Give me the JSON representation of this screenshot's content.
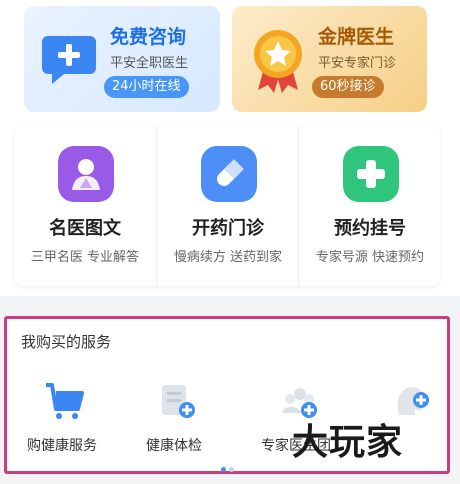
{
  "cards": [
    {
      "title": "免费咨询",
      "subtitle": "平安全职医生",
      "pill": "24小时在线",
      "icon": "chat-plus-icon"
    },
    {
      "title": "金牌医生",
      "subtitle": "平安专家门诊",
      "pill": "60秒接诊",
      "icon": "medal-star-icon"
    }
  ],
  "services": [
    {
      "title": "名医图文",
      "subtitle": "三甲名医 专业解答",
      "icon": "doctor-portrait-icon",
      "color": "#9a5ae8"
    },
    {
      "title": "开药门诊",
      "subtitle": "慢病续方 送药到家",
      "icon": "pill-capsule-icon",
      "color": "#4e8ef7"
    },
    {
      "title": "预约挂号",
      "subtitle": "专家号源 快速预约",
      "icon": "medical-cross-icon",
      "color": "#2fc57d"
    }
  ],
  "purchased": {
    "title": "我购买的服务",
    "items": [
      {
        "label": "购健康服务",
        "icon": "cart-icon"
      },
      {
        "label": "健康体检",
        "icon": "checkup-icon"
      },
      {
        "label": "专家医生团",
        "icon": "expert-team-icon"
      },
      {
        "label": "",
        "icon": "head-add-icon"
      }
    ]
  },
  "watermark": {
    "text": "大玩家"
  },
  "colors": {
    "accent": "#3f8ef5",
    "highlight_border": "#cc3d7f"
  }
}
